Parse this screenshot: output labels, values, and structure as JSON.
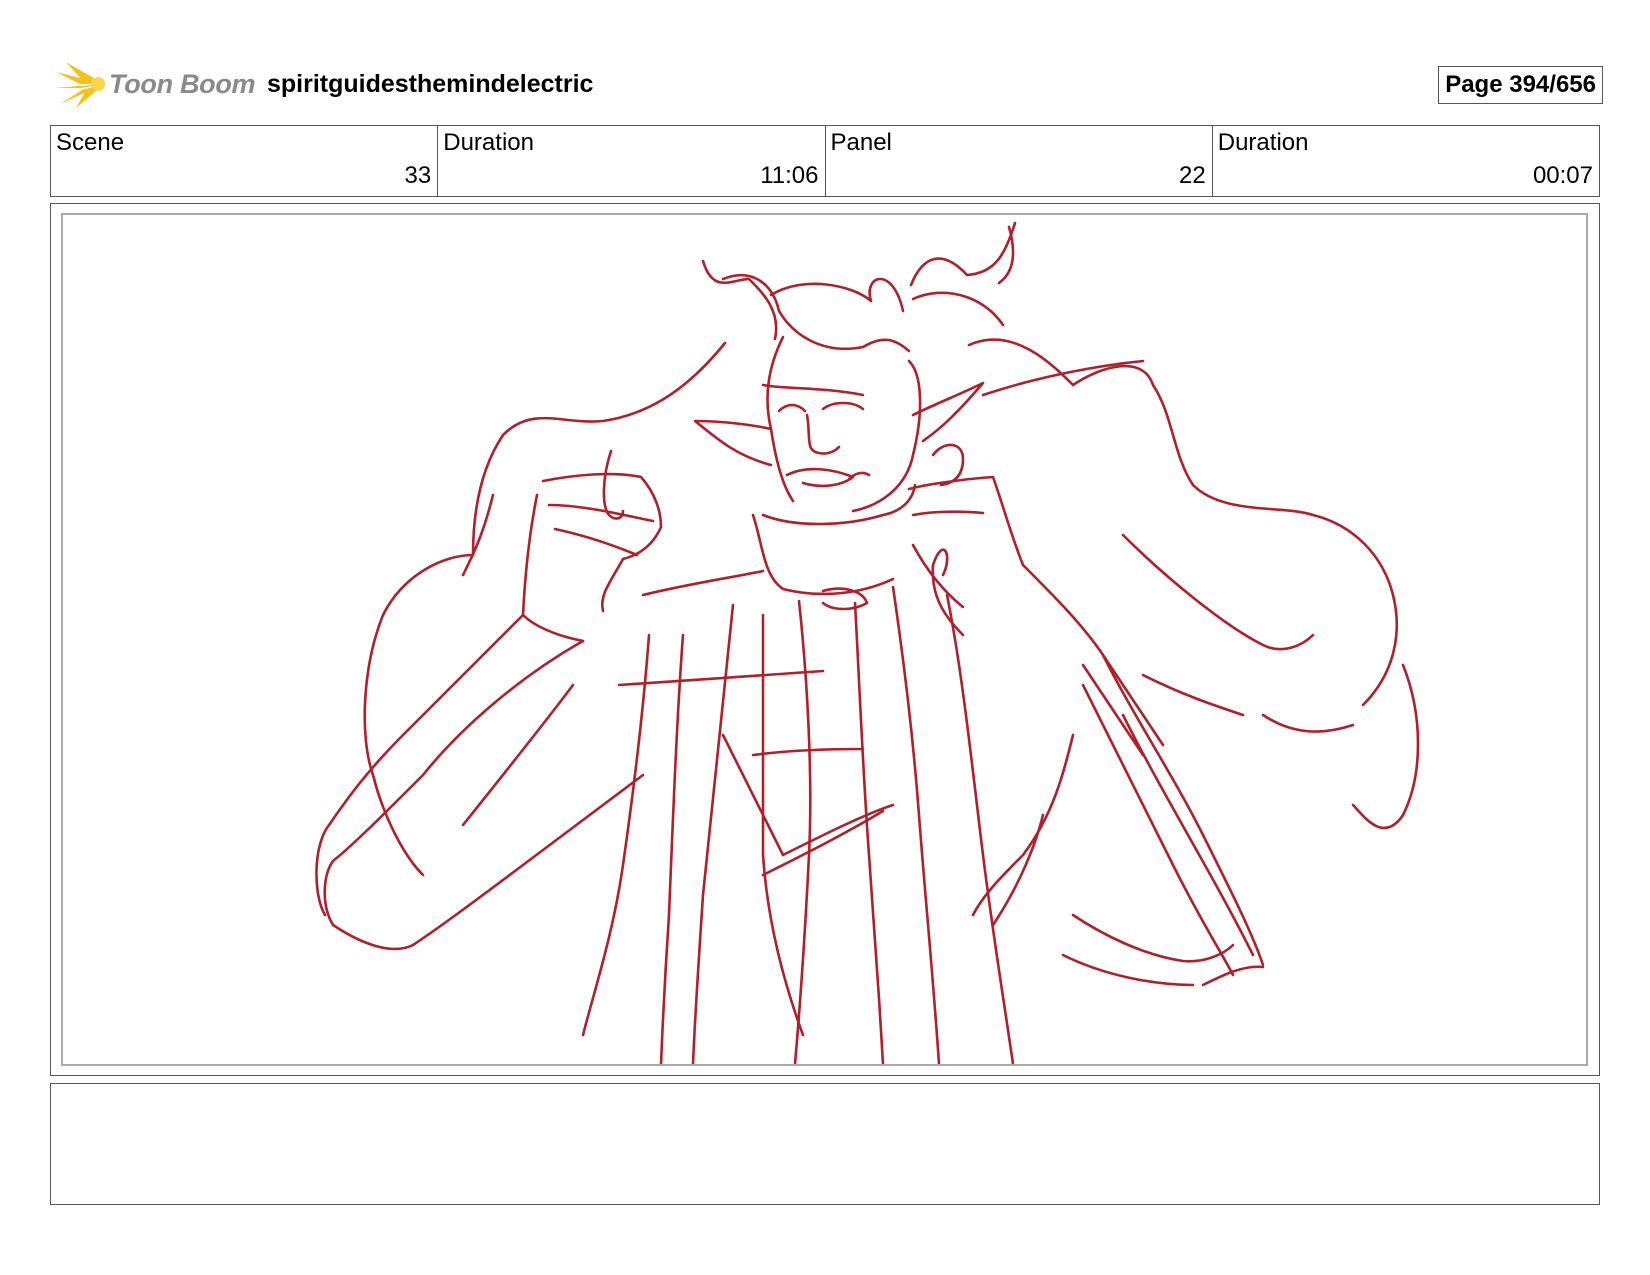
{
  "header": {
    "logo_text": "Toon Boom",
    "project_title": "spiritguidesthemindelectric",
    "page_label": "Page 394/656"
  },
  "info": [
    {
      "label": "Scene",
      "value": "33"
    },
    {
      "label": "Duration",
      "value": "11:06"
    },
    {
      "label": "Panel",
      "value": "22"
    },
    {
      "label": "Duration",
      "value": "00:07"
    }
  ],
  "colors": {
    "sketch": "#b0202a",
    "logo_accent": "#f6c21a",
    "border": "#555555"
  },
  "notes": {
    "text": ""
  }
}
